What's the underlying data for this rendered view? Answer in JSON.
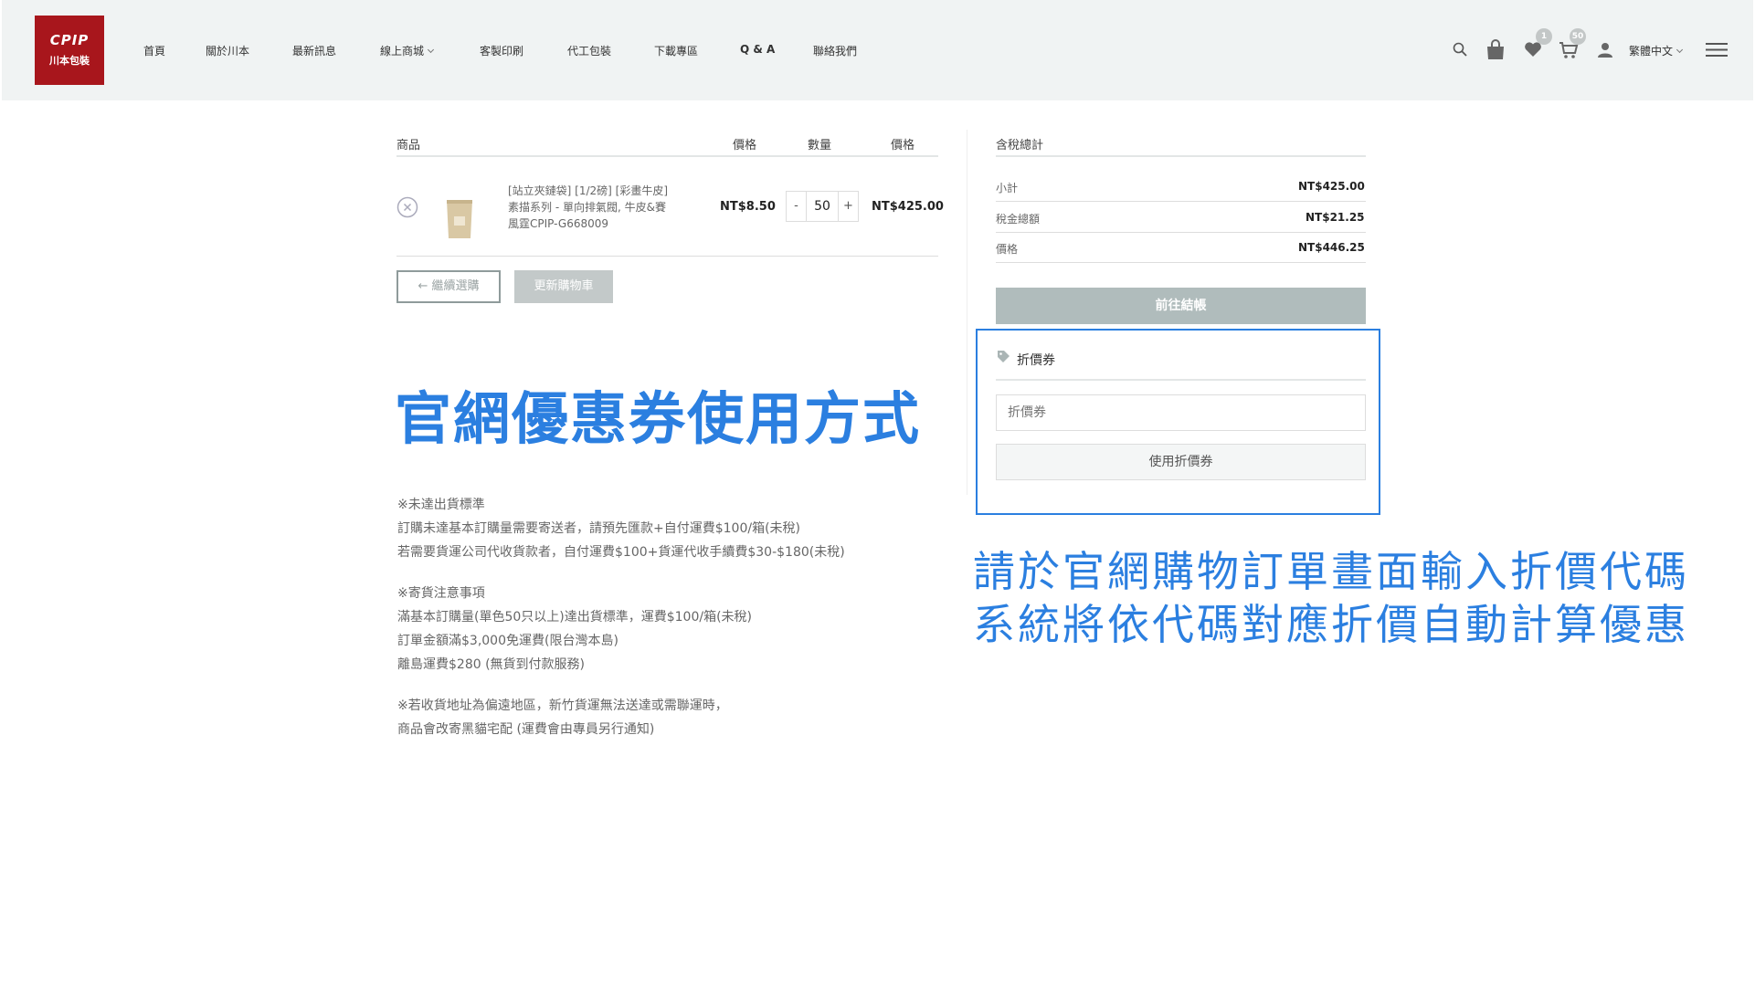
{
  "logo": {
    "brand": "CPIP",
    "name": "川本包裝"
  },
  "nav": [
    "首頁",
    "關於川本",
    "最新訊息",
    "線上商城",
    "客製印刷",
    "代工包裝",
    "下載專區",
    "Q & A",
    "聯絡我們"
  ],
  "header_icons": {
    "wishlist_count": "1",
    "cart_count": "50",
    "language": "繁體中文"
  },
  "cart": {
    "headers": {
      "product": "商品",
      "price": "價格",
      "qty": "數量",
      "total": "價格"
    },
    "item": {
      "name_lines": [
        "[站立夾鏈袋] [1/2磅] [彩畫牛皮]",
        "素描系列 - 單向排氣閥, 牛皮&賽",
        "風霆CPIP-G668009"
      ],
      "price": "NT$8.50",
      "qty_minus": "-",
      "qty": "50",
      "qty_plus": "+",
      "total": "NT$425.00"
    },
    "continue_btn": "← 繼續選購",
    "update_btn": "更新購物車"
  },
  "summary": {
    "title": "含稅總計",
    "rows": [
      {
        "label": "小計",
        "value": "NT$425.00"
      },
      {
        "label": "稅金總額",
        "value": "NT$21.25"
      },
      {
        "label": "價格",
        "value": "NT$446.25"
      }
    ],
    "checkout_btn": "前往結帳"
  },
  "coupon": {
    "title": "折價券",
    "placeholder": "折價券",
    "apply_btn": "使用折價券"
  },
  "headline": "官網優惠券使用方式",
  "notes": [
    [
      "※未達出貨標準",
      "訂購未達基本訂購量需要寄送者，請預先匯款+自付運費$100/箱(未稅)",
      "若需要貨運公司代收貨款者，自付運費$100+貨運代收手續費$30-$180(未稅)"
    ],
    [
      "※寄貨注意事項",
      "滿基本訂購量(單色50只以上)達出貨標準，運費$100/箱(未稅)",
      "訂單金額滿$3,000免運費(限台灣本島)",
      "離島運費$280 (無貨到付款服務)"
    ],
    [
      "※若收貨地址為偏遠地區，新竹貨運無法送達或需聯運時，",
      "商品會改寄黑貓宅配 (運費會由專員另行通知)"
    ]
  ],
  "instruction": [
    "請於官網購物訂單畫面輸入折價代碼",
    "系統將依代碼對應折價自動計算優惠"
  ],
  "colors": {
    "brand_red": "#a8161c",
    "accent_blue": "#2b7fe0",
    "button_grey": "#b0bcbc"
  }
}
